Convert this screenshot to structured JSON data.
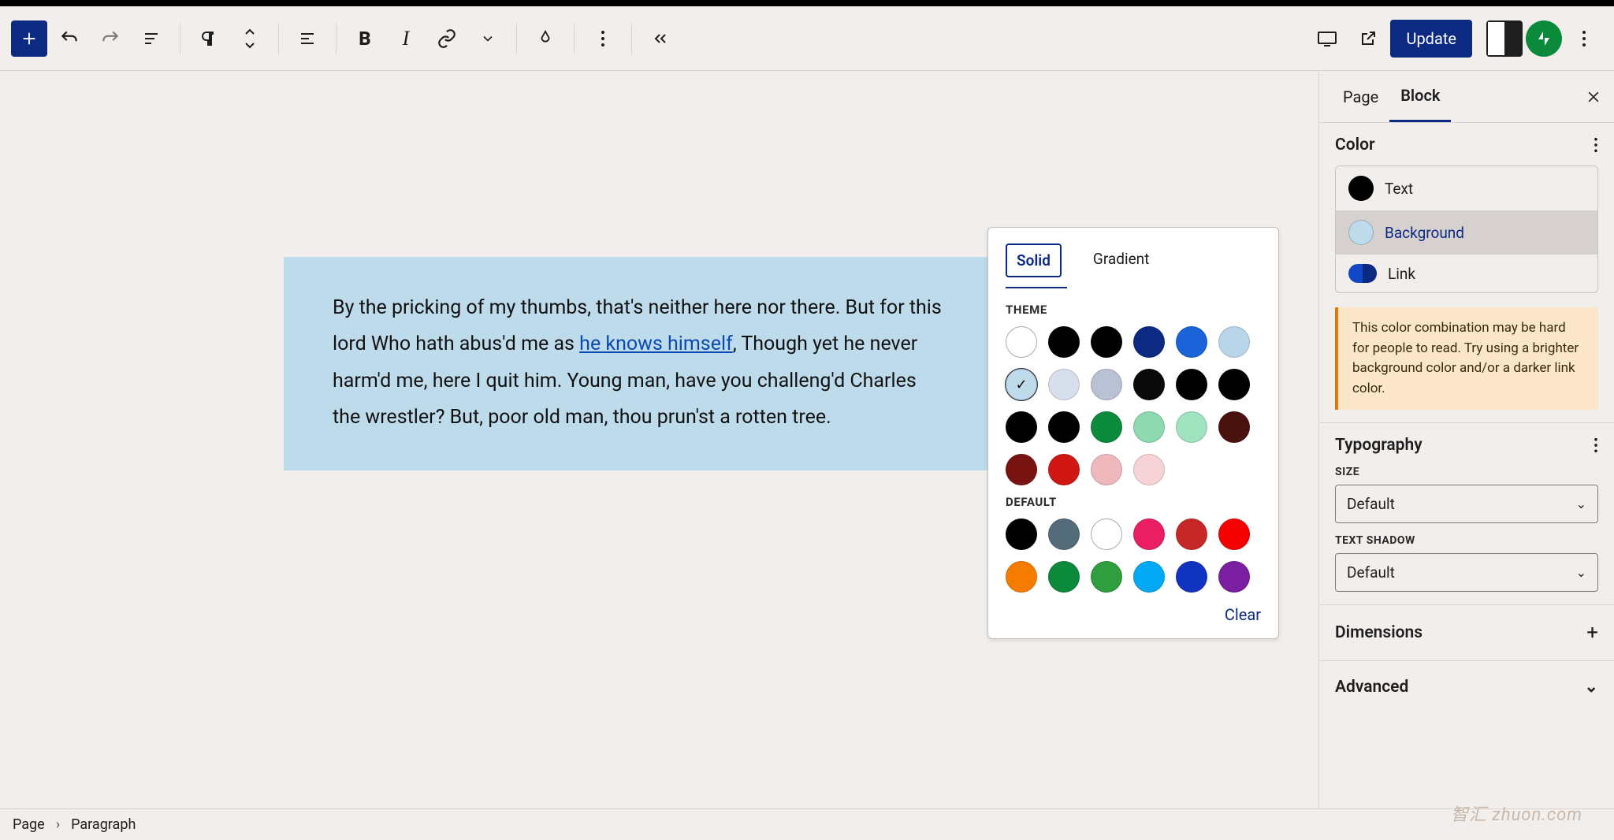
{
  "toolbar": {
    "update_label": "Update"
  },
  "paragraph": {
    "text_before_link": "By the pricking of my thumbs, that's neither here nor there. But for this lord Who hath abus'd me as ",
    "link_text": "he knows himself",
    "text_after_link": ", Though yet he never harm'd me, here I quit him. Young man, have you challeng'd Charles the wrestler? But, poor old man, thou prun'st a rotten tree."
  },
  "color_popover": {
    "tabs": {
      "solid": "Solid",
      "gradient": "Gradient"
    },
    "theme_label": "THEME",
    "default_label": "DEFAULT",
    "clear_label": "Clear",
    "theme_colors": [
      "#ffffff",
      "#000000",
      "#000000",
      "#0d2a83",
      "#1a63d8",
      "#b8d5ea",
      "#bedbeb",
      "#d7deec",
      "#b8c2d4",
      "#0a0a0a",
      "#000000",
      "#000000",
      "#000000",
      "#000000",
      "#0b8a3b",
      "#8ed9b0",
      "#9fe3bf",
      "#4a120f",
      "#7a1410",
      "#d01714",
      "#efb8bd",
      "#f6d3d6"
    ],
    "theme_selected_index": 6,
    "default_colors": [
      "#000000",
      "#546b7a",
      "#ffffff",
      "#e91e63",
      "#c62828",
      "#f40000",
      "#f57c00",
      "#0b8a3b",
      "#2e9e3f",
      "#03a9f4",
      "#1034c0",
      "#7b1fa2"
    ]
  },
  "sidebar": {
    "tabs": {
      "page": "Page",
      "block": "Block"
    },
    "color": {
      "title": "Color",
      "text_label": "Text",
      "text_color": "#000000",
      "background_label": "Background",
      "background_color": "#bedbeb",
      "link_label": "Link",
      "warning": "This color combination may be hard for people to read. Try using a brighter background color and/or a darker link color."
    },
    "typography": {
      "title": "Typography",
      "size_label": "SIZE",
      "size_value": "Default",
      "shadow_label": "TEXT SHADOW",
      "shadow_value": "Default"
    },
    "dimensions_label": "Dimensions",
    "advanced_label": "Advanced"
  },
  "breadcrumb": {
    "root": "Page",
    "leaf": "Paragraph"
  },
  "watermark": {
    "main": "智汇 zhuon.com"
  }
}
